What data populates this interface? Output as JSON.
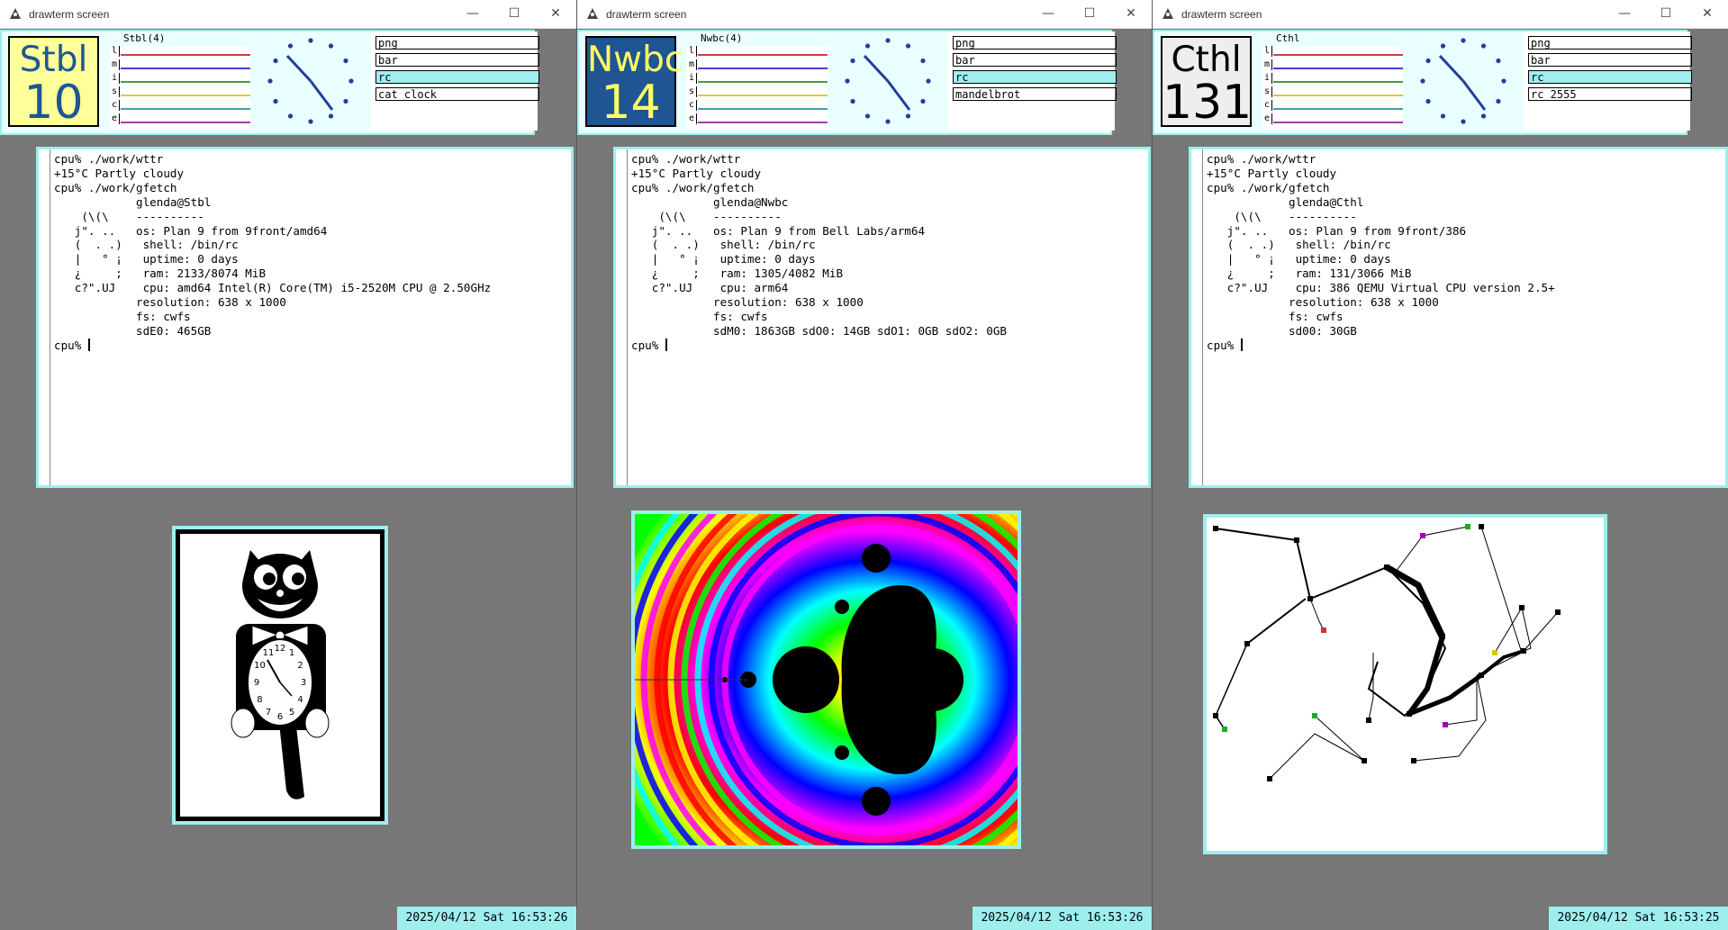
{
  "colors": {
    "desktop": "#777777",
    "bar_bg": "#eaffff",
    "accent": "#9eeeee",
    "host1_bg": "#ffff99",
    "host2_bg": "#1f5592",
    "host2_fg": "#ffff66",
    "host3_bg": "#eeeeee"
  },
  "windows": [
    {
      "title": "drawterm screen",
      "host": {
        "name": "Stbl",
        "number": "10"
      },
      "stats": {
        "title": "Stbl(4)",
        "labels": [
          "l",
          "m",
          "i",
          "s",
          "c",
          "e"
        ]
      },
      "menu": [
        "png",
        "bar",
        "rc",
        "cat clock"
      ],
      "menu_selected": 2,
      "terminal": [
        "cpu% ./work/wttr",
        "+15°C Partly cloudy",
        "cpu% ./work/gfetch",
        "            glenda@Stbl",
        "    (\\(\\    ----------",
        "   j\". ..   os: Plan 9 from 9front/amd64",
        "   (  . .)   shell: /bin/rc",
        "   |   ° ¡   uptime: 0 days",
        "   ¿     ;   ram: 2133/8074 MiB",
        "   c?\".UJ    cpu: amd64 Intel(R) Core(TM) i5-2520M CPU @ 2.50GHz",
        "            resolution: 638 x 1000",
        "            fs: cwfs",
        "            sdE0: 465GB",
        "cpu% "
      ],
      "date": "2025/04/12 Sat 16:53:26"
    },
    {
      "title": "drawterm screen",
      "host": {
        "name": "Nwbc",
        "number": "14"
      },
      "stats": {
        "title": "Nwbc(4)",
        "labels": [
          "l",
          "m",
          "i",
          "s",
          "c",
          "e"
        ]
      },
      "menu": [
        "png",
        "bar",
        "rc",
        "mandelbrot"
      ],
      "menu_selected": 2,
      "terminal": [
        "cpu% ./work/wttr",
        "+15°C Partly cloudy",
        "cpu% ./work/gfetch",
        "            glenda@Nwbc",
        "    (\\(\\    ----------",
        "   j\". ..   os: Plan 9 from Bell Labs/arm64",
        "   (  . .)   shell: /bin/rc",
        "   |   ° ¡   uptime: 0 days",
        "   ¿     ;   ram: 1305/4082 MiB",
        "   c?\".UJ    cpu: arm64",
        "            resolution: 638 x 1000",
        "            fs: cwfs",
        "            sdM0: 1863GB sdO0: 14GB sdO1: 0GB sdO2: 0GB",
        "cpu% "
      ],
      "date": "2025/04/12 Sat 16:53:26"
    },
    {
      "title": "drawterm screen",
      "host": {
        "name": "Cthl",
        "number": "131"
      },
      "stats": {
        "title": "Cthl",
        "labels": [
          "l",
          "m",
          "i",
          "s",
          "c",
          "e"
        ]
      },
      "menu": [
        "png",
        "bar",
        "rc",
        "rc 2555"
      ],
      "menu_selected": 2,
      "terminal": [
        "cpu% ./work/wttr",
        "+15°C Partly cloudy",
        "cpu% ./work/gfetch",
        "            glenda@Cthl",
        "    (\\(\\    ----------",
        "   j\". ..   os: Plan 9 from 9front/386",
        "   (  . .)   shell: /bin/rc",
        "   |   ° ¡   uptime: 0 days",
        "   ¿     ;   ram: 131/3066 MiB",
        "   c?\".UJ    cpu: 386 QEMU Virtual CPU version 2.5+",
        "            resolution: 638 x 1000",
        "            fs: cwfs",
        "            sd00: 30GB",
        "cpu% "
      ],
      "date": "2025/04/12 Sat 16:53:25"
    }
  ],
  "catclock": {
    "numerals": [
      "12",
      "1",
      "2",
      "3",
      "4",
      "5",
      "6",
      "7",
      "8",
      "9",
      "10",
      "11"
    ]
  }
}
